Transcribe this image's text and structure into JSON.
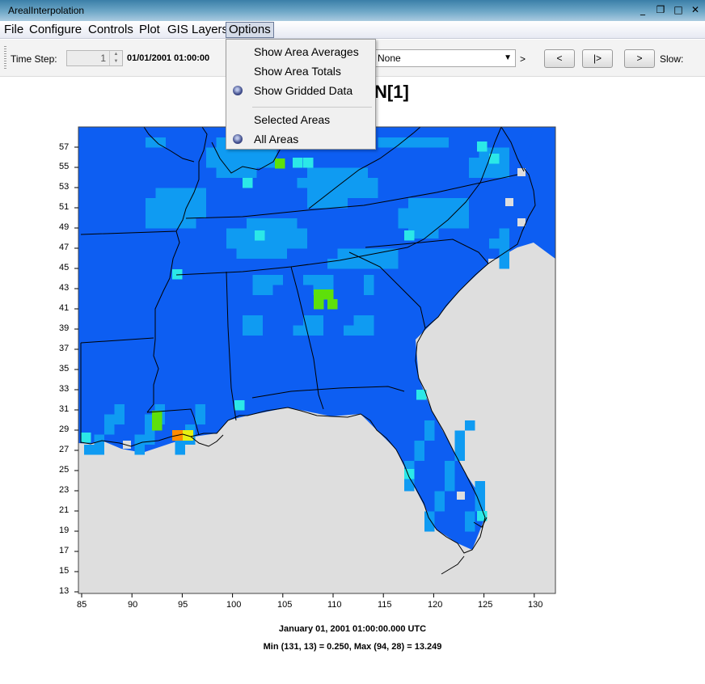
{
  "window": {
    "title": "ArealInterpolation",
    "controls": [
      "_",
      "❐",
      "□",
      "✕"
    ]
  },
  "menubar": {
    "items": [
      "File",
      "Configure",
      "Controls",
      "Plot",
      "GIS Layers",
      "Options"
    ]
  },
  "toolbar": {
    "time_step_label": "Time Step:",
    "time_step_value": "1",
    "date_text": "01/01/2001 01:00:00",
    "combo_value": "None",
    "after_combo": ">",
    "buttons": [
      "<",
      "|>",
      ">"
    ],
    "slow_label": "Slow:"
  },
  "map_title": "N[1]",
  "options_menu": {
    "items": [
      {
        "label": "Show Area Averages",
        "selected": false
      },
      {
        "label": "Show Area Totals",
        "selected": false
      },
      {
        "label": "Show Gridded Data",
        "selected": true
      },
      {
        "label": "Selected Areas",
        "selected": false
      },
      {
        "label": "All Areas",
        "selected": true
      }
    ]
  },
  "axes": {
    "x_ticks": [
      "85",
      "90",
      "95",
      "100",
      "105",
      "110",
      "115",
      "120",
      "125",
      "130"
    ],
    "y_ticks": [
      "57",
      "55",
      "53",
      "51",
      "49",
      "47",
      "45",
      "43",
      "41",
      "39",
      "37",
      "35",
      "33",
      "31",
      "29",
      "27",
      "25",
      "23",
      "21",
      "19",
      "17",
      "15",
      "13"
    ]
  },
  "captions": {
    "time": "January 01, 2001 01:00:00.000 UTC",
    "stats": "Min (131, 13) = 0.250, Max (94, 28) = 13.249"
  },
  "colors": {
    "base_blue": "#0d5ef2",
    "light_blue": "#0f9bf2",
    "cyan": "#2be8e8",
    "green": "#5ee00a",
    "orange": "#ff8c00",
    "yellow": "#e6f012",
    "missing": "#dedede",
    "titlebar": "#3b7fa8"
  }
}
